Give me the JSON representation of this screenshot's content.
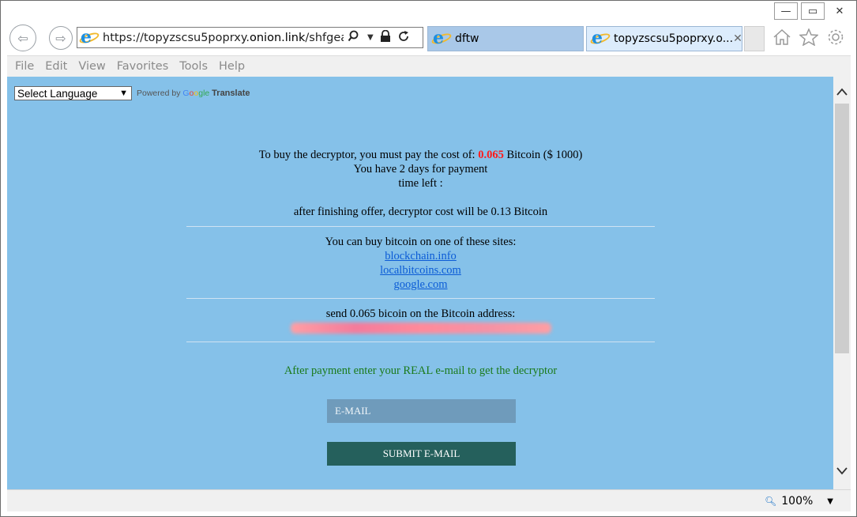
{
  "window": {
    "minimize": "—",
    "maximize": "▭",
    "close": "✕"
  },
  "nav": {
    "url_prefix": "https://topyzscsu5poprxy.",
    "url_domain": "onion.link",
    "url_suffix": "/shfgealjh.",
    "tabs": [
      {
        "label": "dftw"
      },
      {
        "label": "topyzscsu5poprxy.o..."
      }
    ]
  },
  "menu": {
    "items": [
      "File",
      "Edit",
      "View",
      "Favorites",
      "Tools",
      "Help"
    ]
  },
  "translate": {
    "select_value": "Select Language",
    "powered_by": "Powered by",
    "google_G": "G",
    "google_o1": "o",
    "google_o2": "o",
    "google_gle": "gle",
    "translate": "Translate"
  },
  "ransom": {
    "line1_prefix": "To buy the decryptor, you must pay the cost of:",
    "price": "0.065",
    "line1_suffix": "Bitcoin ($ 1000)",
    "line2": "You have 2 days for payment",
    "line3": "time left :",
    "line4": "after finishing offer, decryptor cost will be 0.13 Bitcoin",
    "buy_text": "You can buy bitcoin on one of these sites:",
    "sites": [
      "blockchain.info",
      "localbitcoins.com",
      "google.com"
    ],
    "send_text": "send 0.065 bicoin on the Bitcoin address:",
    "after_payment": "After payment enter your REAL e-mail to get the decryptor",
    "email_placeholder": "E-MAIL",
    "submit_label": "SUBMIT E-MAIL"
  },
  "status": {
    "zoom": "100%"
  },
  "colors": {
    "page_bg": "#85c1e9",
    "price": "#ff1a1a",
    "link": "#0b5bd6",
    "green_text": "#1a7a1a",
    "submit_bg": "#25605c",
    "email_bg": "#6f9bbb"
  },
  "icons": [
    "back-arrow-icon",
    "forward-arrow-icon",
    "ie-logo-icon",
    "search-icon",
    "lock-icon",
    "refresh-icon",
    "home-icon",
    "star-icon",
    "gear-icon",
    "zoom-icon"
  ]
}
